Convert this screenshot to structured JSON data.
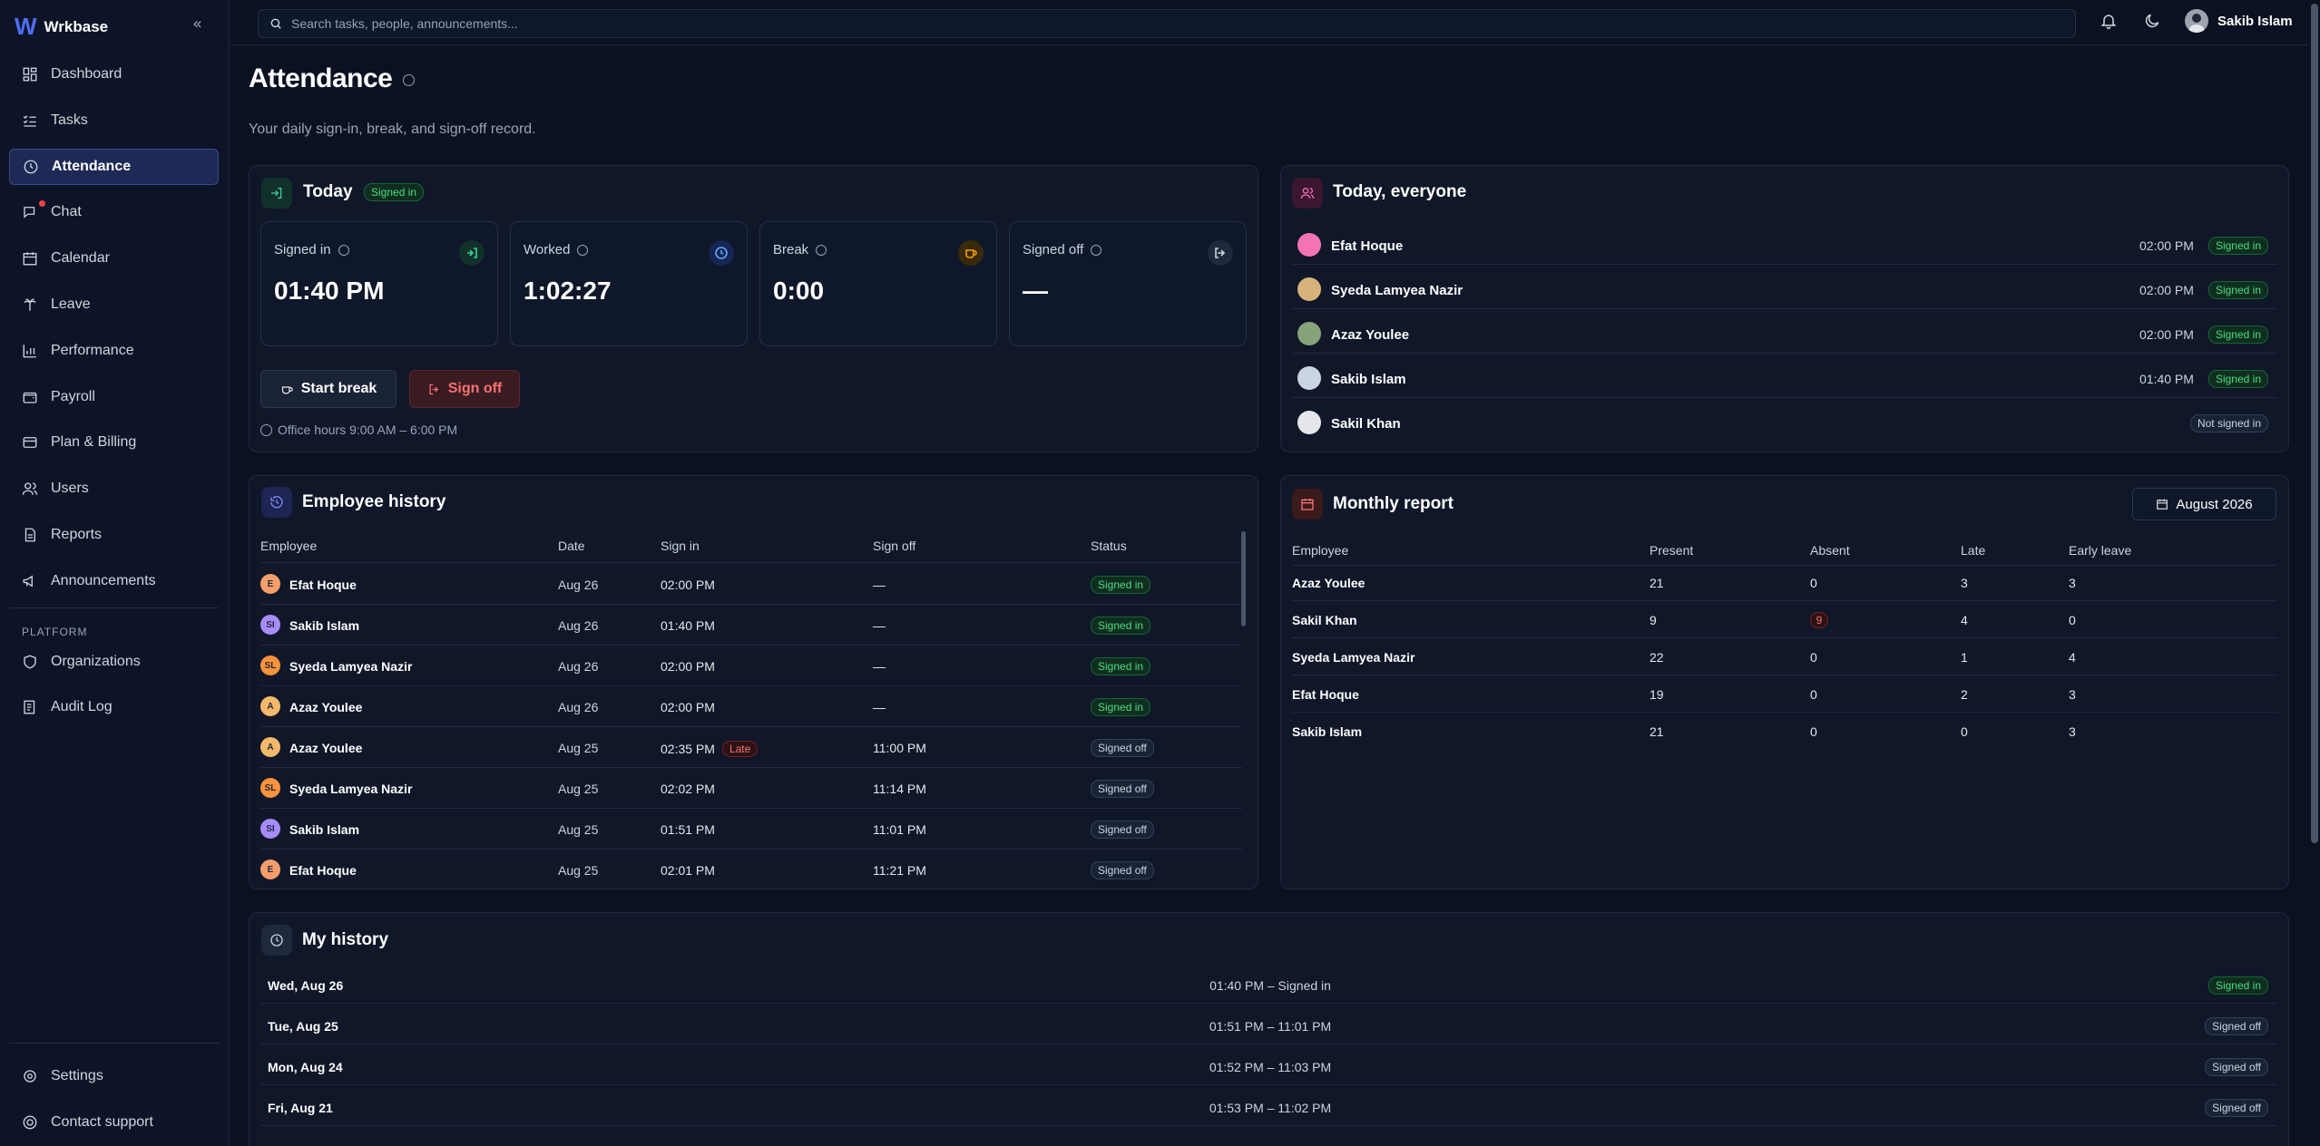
{
  "app": {
    "name": "Wrkbase"
  },
  "sidebar": {
    "items": [
      {
        "label": "Dashboard"
      },
      {
        "label": "Tasks"
      },
      {
        "label": "Attendance"
      },
      {
        "label": "Chat"
      },
      {
        "label": "Calendar"
      },
      {
        "label": "Leave"
      },
      {
        "label": "Performance"
      },
      {
        "label": "Payroll"
      },
      {
        "label": "Plan & Billing"
      },
      {
        "label": "Users"
      },
      {
        "label": "Reports"
      },
      {
        "label": "Announcements"
      }
    ],
    "platform_label": "PLATFORM",
    "platform_items": [
      {
        "label": "Organizations"
      },
      {
        "label": "Audit Log"
      }
    ],
    "bottom_items": [
      {
        "label": "Settings"
      },
      {
        "label": "Contact support"
      }
    ]
  },
  "topbar": {
    "search_placeholder": "Search tasks, people, announcements...",
    "user_name": "Sakib Islam"
  },
  "page": {
    "title": "Attendance",
    "subtitle": "Your daily sign-in, break, and sign-off record."
  },
  "today": {
    "title": "Today",
    "status": "Signed in",
    "stats": [
      {
        "label": "Signed in",
        "value": "01:40 PM"
      },
      {
        "label": "Worked",
        "value": "1:02:27"
      },
      {
        "label": "Break",
        "value": "0:00"
      },
      {
        "label": "Signed off",
        "value": "—"
      }
    ],
    "start_break": "Start break",
    "sign_off": "Sign off",
    "office_hours": "Office hours 9:00 AM – 6:00 PM"
  },
  "everyone": {
    "title": "Today, everyone",
    "rows": [
      {
        "name": "Efat Hoque",
        "time": "02:00 PM",
        "status": "Signed in"
      },
      {
        "name": "Syeda Lamyea Nazir",
        "time": "02:00 PM",
        "status": "Signed in"
      },
      {
        "name": "Azaz Youlee",
        "time": "02:00 PM",
        "status": "Signed in"
      },
      {
        "name": "Sakib Islam",
        "time": "01:40 PM",
        "status": "Signed in"
      },
      {
        "name": "Sakil Khan",
        "time": "",
        "status": "Not signed in"
      }
    ]
  },
  "history": {
    "title": "Employee history",
    "columns": [
      "Employee",
      "Date",
      "Sign in",
      "Sign off",
      "Status"
    ],
    "rows": [
      {
        "initials": "E",
        "name": "Efat Hoque",
        "date": "Aug 26",
        "sign_in": "02:00 PM",
        "late": "",
        "sign_off": "—",
        "status": "Signed in"
      },
      {
        "initials": "SI",
        "name": "Sakib Islam",
        "date": "Aug 26",
        "sign_in": "01:40 PM",
        "late": "",
        "sign_off": "—",
        "status": "Signed in"
      },
      {
        "initials": "SL",
        "name": "Syeda Lamyea Nazir",
        "date": "Aug 26",
        "sign_in": "02:00 PM",
        "late": "",
        "sign_off": "—",
        "status": "Signed in"
      },
      {
        "initials": "A",
        "name": "Azaz Youlee",
        "date": "Aug 26",
        "sign_in": "02:00 PM",
        "late": "",
        "sign_off": "—",
        "status": "Signed in"
      },
      {
        "initials": "A",
        "name": "Azaz Youlee",
        "date": "Aug 25",
        "sign_in": "02:35 PM",
        "late": "Late",
        "sign_off": "11:00 PM",
        "status": "Signed off"
      },
      {
        "initials": "SL",
        "name": "Syeda Lamyea Nazir",
        "date": "Aug 25",
        "sign_in": "02:02 PM",
        "late": "",
        "sign_off": "11:14 PM",
        "status": "Signed off"
      },
      {
        "initials": "SI",
        "name": "Sakib Islam",
        "date": "Aug 25",
        "sign_in": "01:51 PM",
        "late": "",
        "sign_off": "11:01 PM",
        "status": "Signed off"
      },
      {
        "initials": "E",
        "name": "Efat Hoque",
        "date": "Aug 25",
        "sign_in": "02:01 PM",
        "late": "",
        "sign_off": "11:21 PM",
        "status": "Signed off"
      }
    ]
  },
  "monthly": {
    "title": "Monthly report",
    "month": "August 2026",
    "columns": [
      "Employee",
      "Present",
      "Absent",
      "Late",
      "Early leave"
    ],
    "rows": [
      {
        "name": "Azaz Youlee",
        "present": "21",
        "absent": "0",
        "late": "3",
        "early": "3"
      },
      {
        "name": "Sakil Khan",
        "present": "9",
        "absent": "9",
        "late": "4",
        "early": "0"
      },
      {
        "name": "Syeda Lamyea Nazir",
        "present": "22",
        "absent": "0",
        "late": "1",
        "early": "4"
      },
      {
        "name": "Efat Hoque",
        "present": "19",
        "absent": "0",
        "late": "2",
        "early": "3"
      },
      {
        "name": "Sakib Islam",
        "present": "21",
        "absent": "0",
        "late": "0",
        "early": "3"
      }
    ]
  },
  "my_history": {
    "title": "My history",
    "rows": [
      {
        "day": "Wed, Aug 26",
        "range": "01:40 PM – Signed in",
        "status": "Signed in"
      },
      {
        "day": "Tue, Aug 25",
        "range": "01:51 PM – 11:01 PM",
        "status": "Signed off"
      },
      {
        "day": "Mon, Aug 24",
        "range": "01:52 PM – 11:03 PM",
        "status": "Signed off"
      },
      {
        "day": "Fri, Aug 21",
        "range": "01:53 PM – 11:02 PM",
        "status": "Signed off"
      }
    ]
  },
  "colors": {
    "accent": "#4f6ef7",
    "signed_in": "#4ade80",
    "danger": "#f87171",
    "bg": "#0b1120"
  }
}
